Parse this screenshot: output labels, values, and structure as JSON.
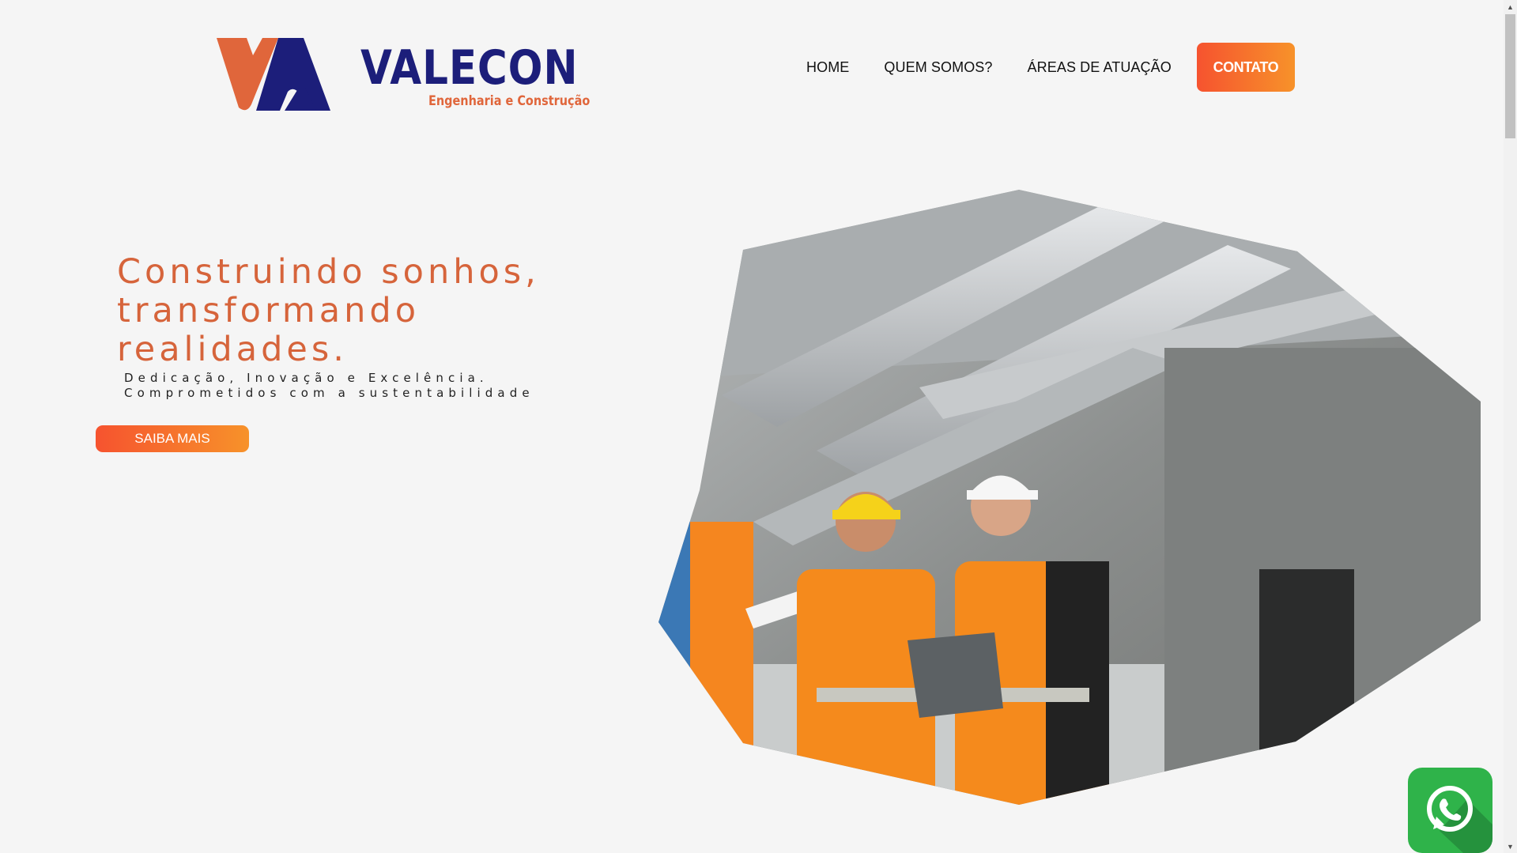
{
  "logo": {
    "name": "VALECON",
    "tagline": "Engenharia e Construção",
    "colors": {
      "navy": "#1c1e7a",
      "orange": "#e0663b"
    }
  },
  "nav": {
    "items": [
      "HOME",
      "QUEM SOMOS?",
      "ÁREAS DE ATUAÇÃO"
    ],
    "contact_label": "CONTATO"
  },
  "hero": {
    "title_lines": [
      "Construindo sonhos,",
      "transformando",
      "realidades."
    ],
    "subtitle_lines": [
      "Dedicação, Inovação e Excelência.",
      "Comprometidos com a sustentabilidade"
    ],
    "cta_label": "SAIBA MAIS",
    "image_subject": "construction-workers-photo"
  },
  "floating": {
    "icon": "whatsapp-icon",
    "color": "#2fb34a"
  },
  "colors": {
    "accent_start": "#f6532f",
    "accent_end": "#f7922a",
    "title": "#d6643b"
  }
}
